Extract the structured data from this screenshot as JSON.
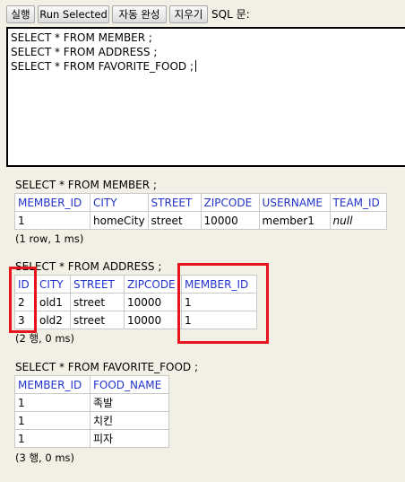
{
  "toolbar": {
    "run": "실행",
    "run_selected": "Run Selected",
    "autocomplete": "자동 완성",
    "clear": "지우기",
    "sql_label": "SQL 문:"
  },
  "editor": {
    "lines": [
      "SELECT * FROM MEMBER ;",
      "SELECT * FROM ADDRESS ;",
      "SELECT * FROM FAVORITE_FOOD ;"
    ]
  },
  "results": [
    {
      "query": "SELECT * FROM MEMBER ;",
      "columns": [
        "MEMBER_ID",
        "CITY",
        "STREET",
        "ZIPCODE",
        "USERNAME",
        "TEAM_ID"
      ],
      "rows": [
        [
          "1",
          "homeCity",
          "street",
          "10000",
          "member1",
          "null"
        ]
      ],
      "meta": "(1 row, 1 ms)"
    },
    {
      "query": "SELECT * FROM ADDRESS ;",
      "columns": [
        "ID",
        "CITY",
        "STREET",
        "ZIPCODE",
        "MEMBER_ID"
      ],
      "rows": [
        [
          "2",
          "old1",
          "street",
          "10000",
          "1"
        ],
        [
          "3",
          "old2",
          "street",
          "10000",
          "1"
        ]
      ],
      "meta": "(2 행, 0 ms)"
    },
    {
      "query": "SELECT * FROM FAVORITE_FOOD ;",
      "columns": [
        "MEMBER_ID",
        "FOOD_NAME"
      ],
      "rows": [
        [
          "1",
          "족발"
        ],
        [
          "1",
          "치킨"
        ],
        [
          "1",
          "피자"
        ]
      ],
      "meta": "(3 행, 0 ms)"
    }
  ],
  "colors": {
    "header_text": "#2233cc",
    "highlight": "#e8141b",
    "background": "#f2f0e4"
  }
}
